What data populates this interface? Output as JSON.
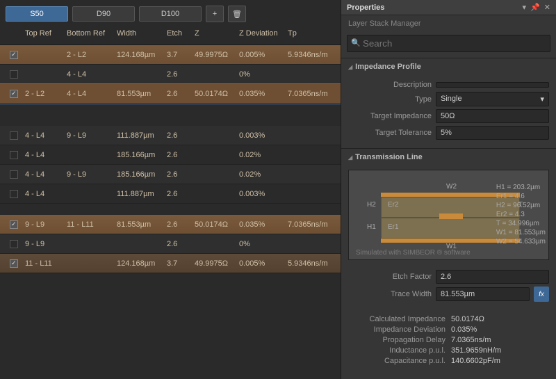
{
  "tabs": [
    "S50",
    "D90",
    "D100"
  ],
  "toolbar": {
    "add_icon": "+",
    "del_icon": "🗑"
  },
  "headers": {
    "top": "Top Ref",
    "bot": "Bottom Ref",
    "w": "Width",
    "e": "Etch",
    "z": "Z",
    "zd": "Z Deviation",
    "tp": "Tp"
  },
  "rows": [
    {
      "kind": "stripe",
      "checked": true,
      "top": "",
      "bot": "2 - L2",
      "w": "124.168µm",
      "e": "3.7",
      "z": "49.9975Ω",
      "zd": "0.005%",
      "tp": "5.9346ns/m"
    },
    {
      "kind": "plain",
      "checked": false,
      "top": "",
      "bot": "4 - L4",
      "w": "",
      "e": "2.6",
      "z": "",
      "zd": "0%",
      "tp": ""
    },
    {
      "kind": "sel",
      "checked": true,
      "top": "2 - L2",
      "bot": "4 - L4",
      "w": "81.553µm",
      "e": "2.6",
      "z": "50.0174Ω",
      "zd": "0.035%",
      "tp": "7.0365ns/m"
    },
    {
      "kind": "gap"
    },
    {
      "kind": "gap"
    },
    {
      "kind": "plain",
      "checked": false,
      "top": "4 - L4",
      "bot": "9 - L9",
      "w": "111.887µm",
      "e": "2.6",
      "z": "",
      "zd": "0.003%",
      "tp": ""
    },
    {
      "kind": "plain",
      "checked": false,
      "top": "4 - L4",
      "bot": "",
      "w": "185.166µm",
      "e": "2.6",
      "z": "",
      "zd": "0.02%",
      "tp": ""
    },
    {
      "kind": "plain",
      "checked": false,
      "top": "4 - L4",
      "bot": "9 - L9",
      "w": "185.166µm",
      "e": "2.6",
      "z": "",
      "zd": "0.02%",
      "tp": ""
    },
    {
      "kind": "plain",
      "checked": false,
      "top": "4 - L4",
      "bot": "",
      "w": "111.887µm",
      "e": "2.6",
      "z": "",
      "zd": "0.003%",
      "tp": ""
    },
    {
      "kind": "gap"
    },
    {
      "kind": "stripe",
      "checked": true,
      "top": "9 - L9",
      "bot": "11 - L11",
      "w": "81.553µm",
      "e": "2.6",
      "z": "50.0174Ω",
      "zd": "0.035%",
      "tp": "7.0365ns/m"
    },
    {
      "kind": "plain",
      "checked": false,
      "top": "9 - L9",
      "bot": "",
      "w": "",
      "e": "2.6",
      "z": "",
      "zd": "0%",
      "tp": ""
    },
    {
      "kind": "stripe-dull",
      "checked": true,
      "top": "11 - L11",
      "bot": "",
      "w": "124.168µm",
      "e": "3.7",
      "z": "49.9975Ω",
      "zd": "0.005%",
      "tp": "5.9346ns/m"
    }
  ],
  "panel": {
    "title": "Properties",
    "subtitle": "Layer Stack Manager",
    "search_ph": "Search",
    "sections": {
      "impedance": "Impedance Profile",
      "transmission": "Transmission Line"
    },
    "form": {
      "desc_l": "Description",
      "desc_v": "",
      "type_l": "Type",
      "type_v": "Single",
      "tz_l": "Target Impedance",
      "tz_v": "50Ω",
      "tt_l": "Target Tolerance",
      "tt_v": "5%"
    },
    "tl": {
      "w1": "W1",
      "w2": "W2",
      "h1": "H1",
      "h2": "H2",
      "t": "T",
      "er1": "Er1",
      "er2": "Er2",
      "vals": [
        "H1 = 203.2µm",
        "Er1 = 4.6",
        "H2 = 96.52µm",
        "Er2 = 4.3",
        "T = 34.996µm",
        "W1 = 81.553µm",
        "W2 = 54.633µm"
      ],
      "note": "Simulated with SIMBEOR ® software"
    },
    "etch_l": "Etch Factor",
    "etch_v": "2.6",
    "tw_l": "Trace Width",
    "tw_v": "81.553µm",
    "fx": "fx",
    "results": [
      {
        "l": "Calculated Impedance",
        "v": "50.0174Ω"
      },
      {
        "l": "Impedance Deviation",
        "v": "0.035%"
      },
      {
        "l": "Propagation Delay",
        "v": "7.0365ns/m"
      },
      {
        "l": "Inductance p.u.l.",
        "v": "351.9659nH/m"
      },
      {
        "l": "Capacitance p.u.l.",
        "v": "140.6602pF/m"
      }
    ]
  }
}
